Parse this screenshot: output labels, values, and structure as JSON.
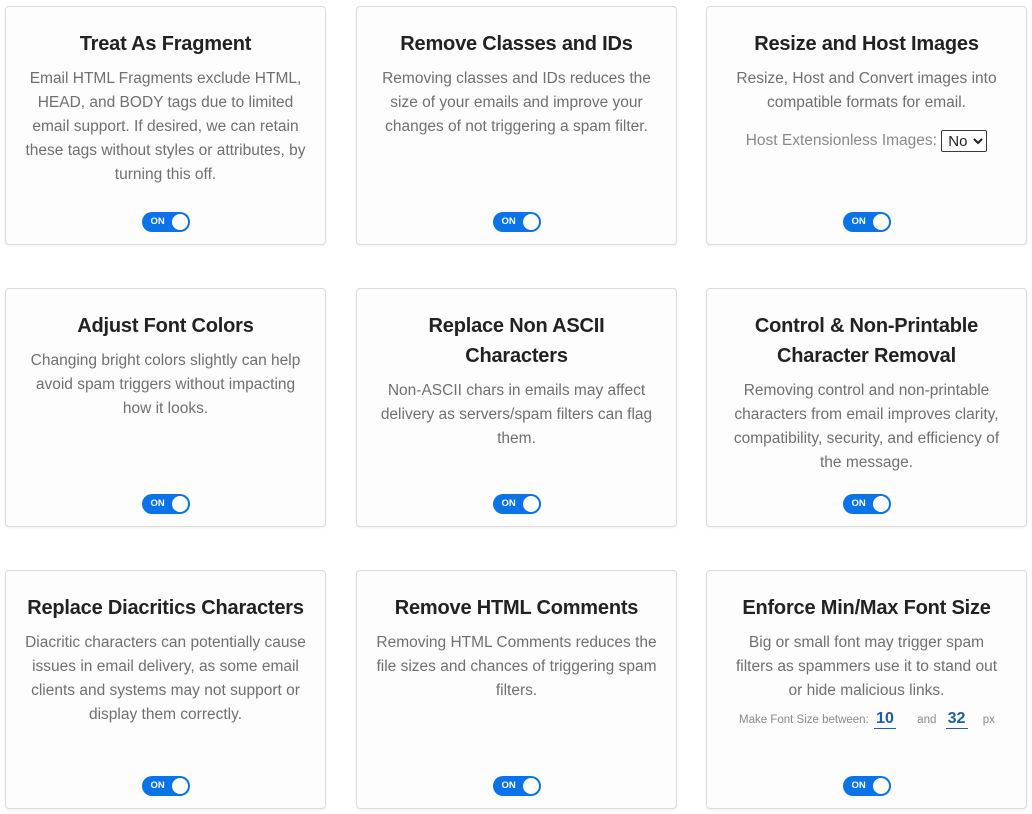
{
  "cards": [
    {
      "title": "Treat As Fragment",
      "description": "Email HTML Fragments exclude HTML, HEAD, and BODY tags due to limited email support. If desired, we can retain these tags without styles or attributes, by turning this off.",
      "toggle": "ON"
    },
    {
      "title": "Remove Classes and IDs",
      "description": "Removing classes and IDs reduces the size of your emails and improve your changes of not triggering a spam filter.",
      "toggle": "ON"
    },
    {
      "title": "Resize and Host Images",
      "description": "Resize, Host and Convert images into compatible formats for email.",
      "option_label": "Host Extensionless Images:",
      "option_value": "No",
      "toggle": "ON"
    },
    {
      "title": "Adjust Font Colors",
      "description": "Changing bright colors slightly can help avoid spam triggers without impacting how it looks.",
      "toggle": "ON"
    },
    {
      "title": "Replace Non ASCII Characters",
      "description": "Non-ASCII chars in emails may affect delivery as servers/spam filters can flag them.",
      "toggle": "ON"
    },
    {
      "title": "Control & Non-Printable Character Removal",
      "description": "Removing control and non-printable characters from email improves clarity, compatibility, security, and efficiency of the message.",
      "toggle": "ON"
    },
    {
      "title": "Replace Diacritics Characters",
      "description": "Diacritic characters can potentially cause issues in email delivery, as some email clients and systems may not support or display them correctly.",
      "toggle": "ON"
    },
    {
      "title": "Remove HTML Comments",
      "description": "Removing HTML Comments reduces the file sizes and chances of triggering spam filters.",
      "toggle": "ON"
    },
    {
      "title": "Enforce Min/Max Font Size",
      "description": "Big or small font may trigger spam filters as spammers use it to stand out or hide malicious links.",
      "font_label": "Make Font Size between:",
      "font_min": "10",
      "font_and": "and",
      "font_max": "32",
      "font_unit": "px",
      "toggle": "ON"
    }
  ],
  "colors": {
    "toggle_on": "#0a73e8",
    "title": "#222222",
    "description": "#707070",
    "font_value": "#1f5da8"
  }
}
